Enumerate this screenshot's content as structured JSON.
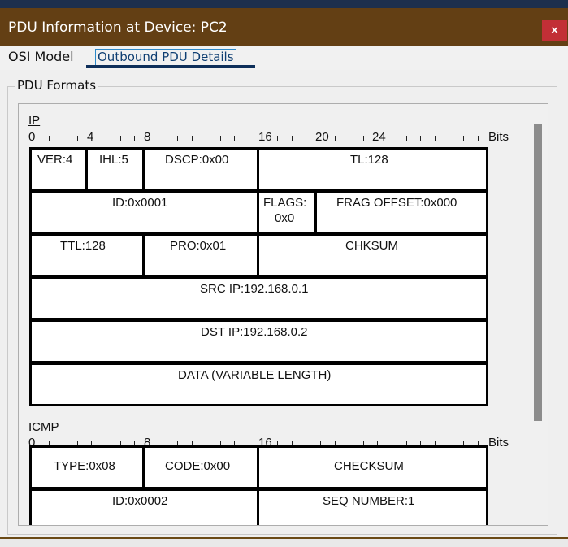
{
  "window": {
    "title": "PDU Information at Device: PC2",
    "close_glyph": "×"
  },
  "tabs": [
    {
      "label": "OSI Model"
    },
    {
      "label": "Outbound PDU Details"
    }
  ],
  "group": {
    "label": "PDU Formats"
  },
  "ip": {
    "title": "IP",
    "ruler": [
      "0",
      "4",
      "8",
      "16",
      "20",
      "24"
    ],
    "bits": "Bits",
    "fields": {
      "ver": "VER:4",
      "ihl": "IHL:5",
      "dscp": "DSCP:0x00",
      "tl": "TL:128",
      "id": "ID:0x0001",
      "flags_line1": "FLAGS:",
      "flags_line2": "0x0",
      "frag": "FRAG OFFSET:0x000",
      "ttl": "TTL:128",
      "pro": "PRO:0x01",
      "chksum": "CHKSUM",
      "src": "SRC IP:192.168.0.1",
      "dst": "DST IP:192.168.0.2",
      "data": "DATA (VARIABLE LENGTH)"
    }
  },
  "icmp": {
    "title": "ICMP",
    "ruler": [
      "0",
      "8",
      "16"
    ],
    "bits": "Bits",
    "fields": {
      "type": "TYPE:0x08",
      "code": "CODE:0x00",
      "checksum": "CHECKSUM",
      "id": "ID:0x0002",
      "seq": "SEQ NUMBER:1"
    }
  }
}
